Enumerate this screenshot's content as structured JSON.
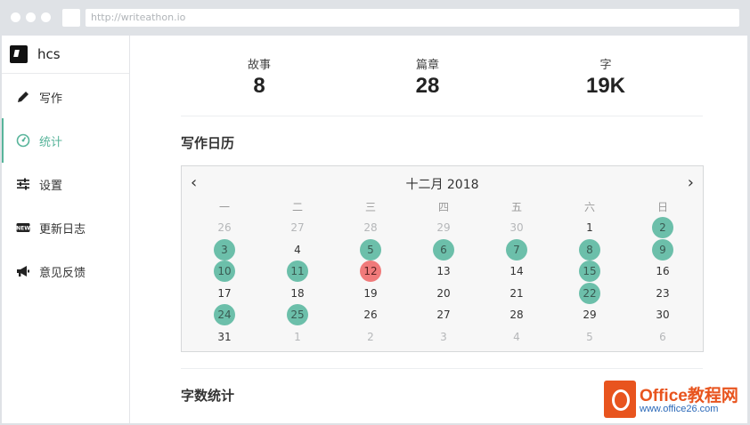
{
  "browser": {
    "url": "http://writeathon.io"
  },
  "brand": {
    "name": "hcs"
  },
  "sidebar": {
    "items": [
      {
        "label": "写作",
        "icon": "pencil-icon"
      },
      {
        "label": "统计",
        "icon": "gauge-icon",
        "active": true
      },
      {
        "label": "设置",
        "icon": "sliders-icon"
      },
      {
        "label": "更新日志",
        "icon": "new-badge-icon"
      },
      {
        "label": "意见反馈",
        "icon": "megaphone-icon"
      }
    ]
  },
  "stats": [
    {
      "label": "故事",
      "value": "8"
    },
    {
      "label": "篇章",
      "value": "28"
    },
    {
      "label": "字",
      "value": "19K"
    }
  ],
  "sections": {
    "calendar_title": "写作日历",
    "word_stats_title": "字数统计"
  },
  "calendar": {
    "month_label": "十二月 2018",
    "prev": "‹",
    "next": "›",
    "weekdays": [
      "一",
      "二",
      "三",
      "四",
      "五",
      "六",
      "日"
    ],
    "weeks": [
      [
        [
          "26",
          "muted"
        ],
        [
          "27",
          "muted"
        ],
        [
          "28",
          "muted"
        ],
        [
          "29",
          "muted"
        ],
        [
          "30",
          "muted"
        ],
        [
          "1",
          ""
        ],
        [
          "2",
          "green"
        ]
      ],
      [
        [
          "3",
          "green"
        ],
        [
          "4",
          ""
        ],
        [
          "5",
          "green"
        ],
        [
          "6",
          "green"
        ],
        [
          "7",
          "green"
        ],
        [
          "8",
          "green"
        ],
        [
          "9",
          "green"
        ]
      ],
      [
        [
          "10",
          "green"
        ],
        [
          "11",
          "green"
        ],
        [
          "12",
          "red"
        ],
        [
          "13",
          ""
        ],
        [
          "14",
          ""
        ],
        [
          "15",
          "green"
        ],
        [
          "16",
          ""
        ]
      ],
      [
        [
          "17",
          ""
        ],
        [
          "18",
          ""
        ],
        [
          "19",
          ""
        ],
        [
          "20",
          ""
        ],
        [
          "21",
          ""
        ],
        [
          "22",
          "green"
        ],
        [
          "23",
          ""
        ]
      ],
      [
        [
          "24",
          "green"
        ],
        [
          "25",
          "green"
        ],
        [
          "26",
          ""
        ],
        [
          "27",
          ""
        ],
        [
          "28",
          ""
        ],
        [
          "29",
          ""
        ],
        [
          "30",
          ""
        ]
      ],
      [
        [
          "31",
          ""
        ],
        [
          "1",
          "muted"
        ],
        [
          "2",
          "muted"
        ],
        [
          "3",
          "muted"
        ],
        [
          "4",
          "muted"
        ],
        [
          "5",
          "muted"
        ],
        [
          "6",
          "muted"
        ]
      ]
    ]
  },
  "colors": {
    "accent": "#57b49a",
    "marked_day": "#6cbfaa",
    "today": "#f07a7a"
  },
  "watermark": {
    "title": "Office教程网",
    "url": "www.office26.com"
  }
}
